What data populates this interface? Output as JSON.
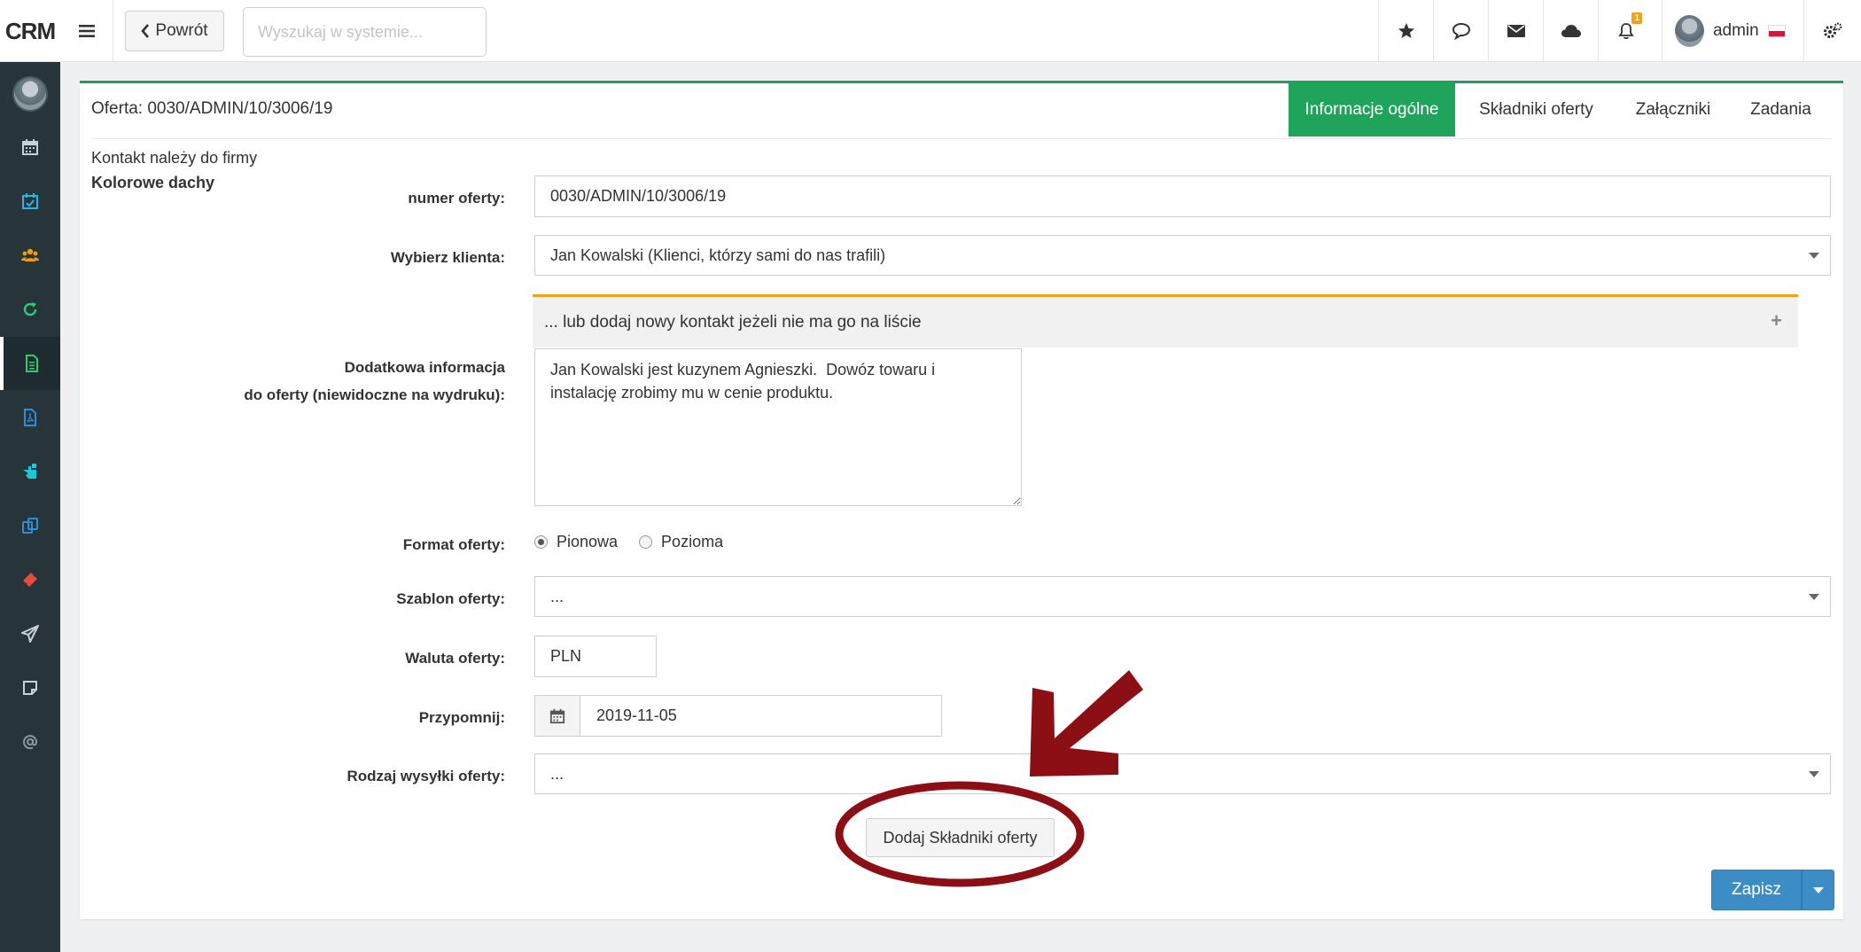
{
  "app": {
    "brand": "CRM"
  },
  "topbar": {
    "back_label": "Powrót",
    "search_placeholder": "Wyszukaj w systemie...",
    "notification_count": "1",
    "user_name": "admin",
    "icons": [
      "star-icon",
      "chat-icon",
      "mail-icon",
      "cloud-icon",
      "bell-icon",
      "settings-icon"
    ]
  },
  "sidebar": {
    "items": [
      {
        "icon": "calendar-icon",
        "color": "#c8d2d6"
      },
      {
        "icon": "calendar-check-icon",
        "color": "#2bb5e8"
      },
      {
        "icon": "users-icon",
        "color": "#f39c12"
      },
      {
        "icon": "refresh-icon",
        "color": "#2ecc71"
      },
      {
        "icon": "document-icon",
        "color": "#2ecc71"
      },
      {
        "icon": "pdf-icon",
        "color": "#2b8fd6"
      },
      {
        "icon": "hand-icon",
        "color": "#1ec6d9"
      },
      {
        "icon": "copy-icon",
        "color": "#2b8fd6"
      },
      {
        "icon": "ticket-icon",
        "color": "#e74c3c"
      },
      {
        "icon": "send-icon",
        "color": "#c8d2d6"
      },
      {
        "icon": "note-icon",
        "color": "#c8d2d6"
      },
      {
        "icon": "at-icon",
        "color": "#8a979d"
      }
    ]
  },
  "card": {
    "title": "Oferta: 0030/ADMIN/10/3006/19",
    "tabs": [
      "Informacje ogólne",
      "Składniki oferty",
      "Załączniki",
      "Zadania"
    ],
    "company_label": "Kontakt należy do firmy",
    "company_name": "Kolorowe dachy"
  },
  "form": {
    "offer_number": {
      "label": "numer oferty:",
      "value": "0030/ADMIN/10/3006/19"
    },
    "client": {
      "label": "Wybierz klienta:",
      "value": "Jan Kowalski (Klienci, którzy sami do nas trafili)"
    },
    "add_contact_panel": "... lub dodaj nowy kontakt jeżeli nie ma go na liście",
    "additional_info": {
      "label_line1": "Dodatkowa informacja",
      "label_line2": "do oferty (niewidoczne na wydruku):",
      "value": "Jan Kowalski jest kuzynem Agnieszki.  Dowóz towaru i instalację zrobimy mu w cenie produktu."
    },
    "format": {
      "label": "Format oferty:",
      "options": [
        "Pionowa",
        "Pozioma"
      ],
      "selected": "Pionowa"
    },
    "template": {
      "label": "Szablon oferty:",
      "value": "..."
    },
    "currency": {
      "label": "Waluta oferty:",
      "value": "PLN"
    },
    "reminder": {
      "label": "Przypomnij:",
      "value": "2019-11-05"
    },
    "shipping": {
      "label": "Rodzaj wysyłki oferty:",
      "value": "..."
    },
    "add_items_button": "Dodaj Składniki oferty",
    "save_button": "Zapisz"
  },
  "annotation": {
    "color": "#8b0f14"
  }
}
